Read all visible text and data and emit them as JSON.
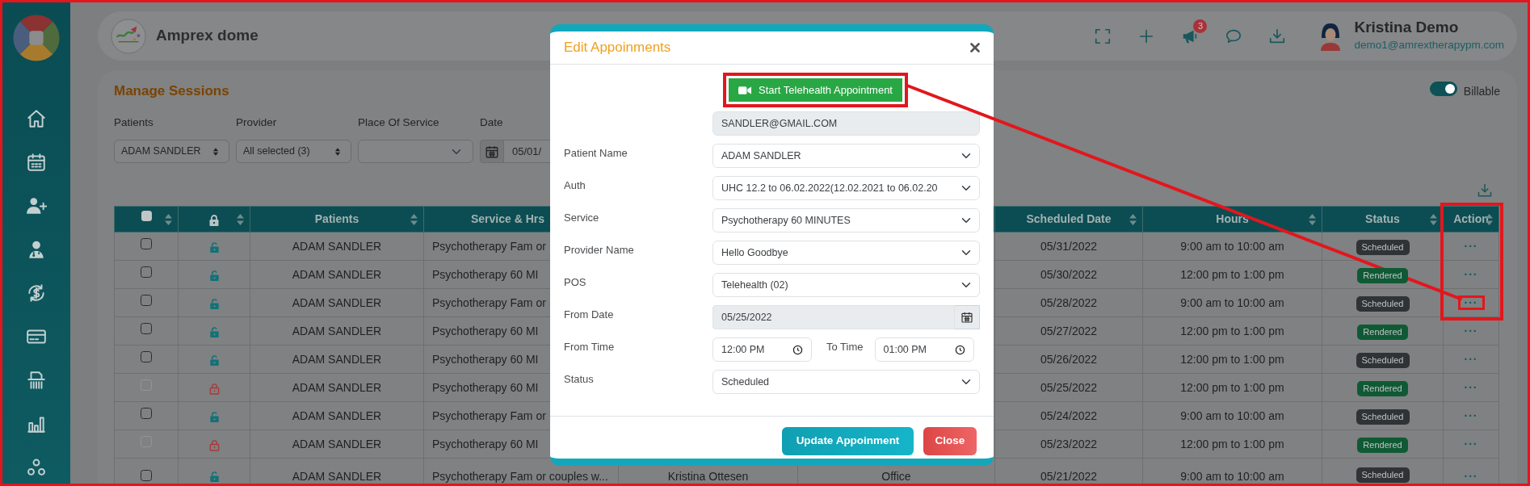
{
  "header": {
    "title": "Amprex dome",
    "notification_count": "3",
    "user": {
      "name": "Kristina Demo",
      "email": "demo1@amrextherapypm.com"
    }
  },
  "page": {
    "title": "Manage Sessions",
    "billable": {
      "label": "Billable",
      "on": true
    },
    "filters": [
      {
        "label": "Patients",
        "kind": "spin-select",
        "value": "ADAM SANDLER"
      },
      {
        "label": "Provider",
        "kind": "spin-select",
        "value": "All selected (3)"
      },
      {
        "label": "Place Of Service",
        "kind": "select"
      },
      {
        "label": "Date",
        "kind": "date",
        "value": "05/01/"
      }
    ]
  },
  "table": {
    "columns": [
      {
        "kind": "checkbox",
        "checked": false
      },
      {
        "kind": "lock"
      },
      {
        "kind": "text",
        "label": "Patients"
      },
      {
        "kind": "text",
        "label": "Service & Hrs"
      },
      {
        "kind": "blank"
      },
      {
        "kind": "blank"
      },
      {
        "kind": "text",
        "label": "Scheduled Date"
      },
      {
        "kind": "text",
        "label": "Hours"
      },
      {
        "kind": "text",
        "label": "Status"
      },
      {
        "kind": "text",
        "label": "Action",
        "highlighted": true
      }
    ],
    "rows": [
      {
        "checked": false,
        "disabled": false,
        "locked": false,
        "patient": "ADAM SANDLER",
        "service": "Psychotherapy Fam or",
        "scheduled_date": "05/31/2022",
        "hours": "9:00 am to 10:00 am",
        "status": {
          "label": "Scheduled",
          "color": "#2f3336"
        },
        "action": "···",
        "highlighted": false
      },
      {
        "checked": false,
        "disabled": false,
        "locked": false,
        "patient": "ADAM SANDLER",
        "service": "Psychotherapy 60 MI",
        "scheduled_date": "05/30/2022",
        "hours": "12:00 pm to 1:00 pm",
        "status": {
          "label": "Rendered",
          "color": "#0f5a35"
        },
        "action": "···",
        "highlighted": false
      },
      {
        "checked": false,
        "disabled": false,
        "locked": false,
        "patient": "ADAM SANDLER",
        "service": "Psychotherapy Fam or",
        "scheduled_date": "05/28/2022",
        "hours": "9:00 am to 10:00 am",
        "status": {
          "label": "Scheduled",
          "color": "#2f3336"
        },
        "action": "···",
        "highlighted": true
      },
      {
        "checked": false,
        "disabled": false,
        "locked": false,
        "patient": "ADAM SANDLER",
        "service": "Psychotherapy 60 MI",
        "scheduled_date": "05/27/2022",
        "hours": "12:00 pm to 1:00 pm",
        "status": {
          "label": "Rendered",
          "color": "#0f5a35"
        },
        "action": "···",
        "highlighted": false
      },
      {
        "checked": false,
        "disabled": false,
        "locked": false,
        "patient": "ADAM SANDLER",
        "service": "Psychotherapy 60 MI",
        "scheduled_date": "05/26/2022",
        "hours": "12:00 pm to 1:00 pm",
        "status": {
          "label": "Scheduled",
          "color": "#2f3336"
        },
        "action": "···",
        "highlighted": false
      },
      {
        "checked": false,
        "disabled": true,
        "locked": true,
        "patient": "ADAM SANDLER",
        "service": "Psychotherapy 60 MI",
        "scheduled_date": "05/25/2022",
        "hours": "12:00 pm to 1:00 pm",
        "status": {
          "label": "Rendered",
          "color": "#0f5a35"
        },
        "action": "···",
        "highlighted": false
      },
      {
        "checked": false,
        "disabled": false,
        "locked": false,
        "patient": "ADAM SANDLER",
        "service": "Psychotherapy Fam or",
        "scheduled_date": "05/24/2022",
        "hours": "9:00 am to 10:00 am",
        "status": {
          "label": "Scheduled",
          "color": "#2f3336"
        },
        "action": "···",
        "highlighted": false
      },
      {
        "checked": false,
        "disabled": true,
        "locked": true,
        "patient": "ADAM SANDLER",
        "service": "Psychotherapy 60 MI",
        "scheduled_date": "05/23/2022",
        "hours": "12:00 pm to 1:00 pm",
        "status": {
          "label": "Rendered",
          "color": "#0f5a35"
        },
        "action": "···",
        "highlighted": false
      },
      {
        "checked": false,
        "disabled": false,
        "locked": false,
        "patient": "ADAM SANDLER",
        "service": "Psychotherapy Fam or couples w...",
        "column_5": "Kristina Ottesen",
        "column_6": "Office",
        "scheduled_date": "05/21/2022",
        "hours": "9:00 am to 10:00 am",
        "status": {
          "label": "Scheduled",
          "color": "#2f3336"
        },
        "action": "···",
        "highlighted": false
      }
    ]
  },
  "modal": {
    "title": "Edit Appoinments",
    "telehealth_button": {
      "label": "Start Telehealth Appointment",
      "highlighted": true
    },
    "fields": [
      {
        "kind": "readonly",
        "value": "SANDLER@GMAIL.COM"
      },
      {
        "label": "Patient Name",
        "kind": "select",
        "value": "ADAM SANDLER"
      },
      {
        "label": "Auth",
        "kind": "select",
        "value": "UHC 12.2 to 06.02.2022(12.02.2021 to 06.02.20"
      },
      {
        "label": "Service",
        "kind": "select",
        "value": "Psychotherapy 60 MINUTES"
      },
      {
        "label": "Provider Name",
        "kind": "select",
        "value": "Hello Goodbye"
      },
      {
        "label": "POS",
        "kind": "select",
        "value": "Telehealth (02)"
      },
      {
        "label": "From Date",
        "kind": "date",
        "value": "05/25/2022"
      },
      {
        "label": "From Time",
        "kind": "time-range",
        "value": "12:00 PM",
        "to_label": "To Time",
        "to_value": "01:00 PM"
      },
      {
        "label": "Status",
        "kind": "select",
        "value": "Scheduled"
      }
    ],
    "buttons": [
      {
        "label": "Update Appoinment",
        "kind": "primary"
      },
      {
        "label": "Close",
        "kind": "danger"
      }
    ]
  }
}
